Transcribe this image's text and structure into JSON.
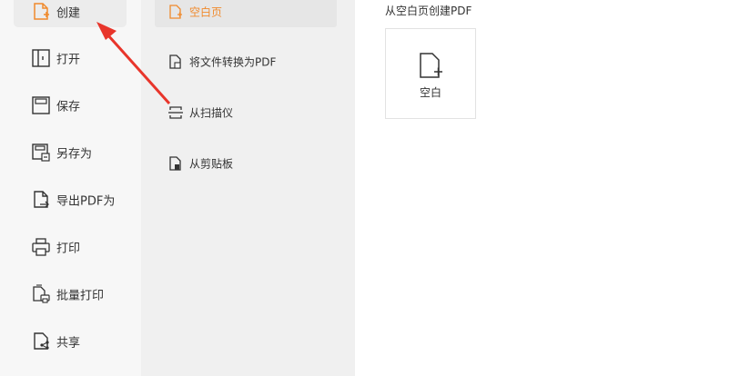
{
  "left_menu": {
    "items": [
      {
        "label": "创建",
        "icon": "create-file-icon",
        "active": true
      },
      {
        "label": "打开",
        "icon": "open-book-icon"
      },
      {
        "label": "保存",
        "icon": "save-icon"
      },
      {
        "label": "另存为",
        "icon": "save-as-icon"
      },
      {
        "label": "导出PDF为",
        "icon": "export-icon"
      },
      {
        "label": "打印",
        "icon": "printer-icon"
      },
      {
        "label": "批量打印",
        "icon": "batch-print-icon"
      },
      {
        "label": "共享",
        "icon": "share-icon"
      }
    ]
  },
  "sub_menu": {
    "items": [
      {
        "label": "空白页",
        "icon": "blank-page-icon",
        "active": true
      },
      {
        "label": "将文件转换为PDF",
        "icon": "convert-file-icon"
      },
      {
        "label": "从扫描仪",
        "icon": "scanner-icon"
      },
      {
        "label": "从剪贴板",
        "icon": "clipboard-icon"
      }
    ]
  },
  "content": {
    "title": "从空白页创建PDF",
    "card_label": "空白"
  },
  "colors": {
    "accent": "#f08a2c",
    "arrow": "#e8352b"
  }
}
